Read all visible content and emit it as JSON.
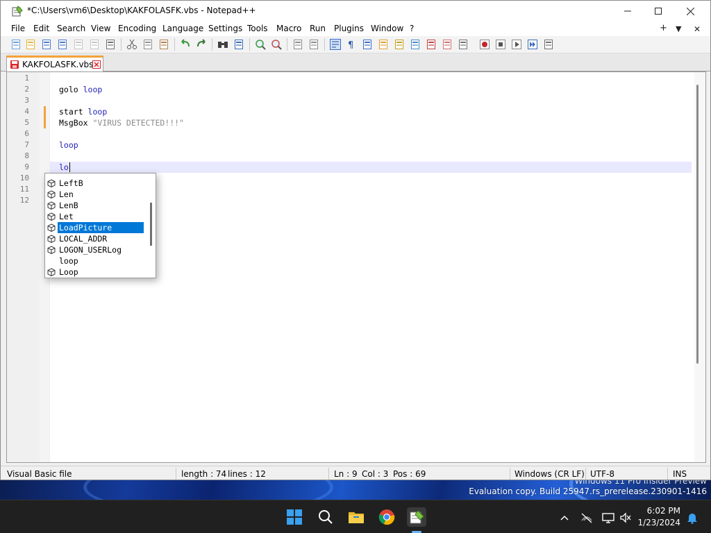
{
  "window": {
    "title": "*C:\\Users\\vm6\\Desktop\\KAKFOLASFK.vbs - Notepad++",
    "minimize_icon": "minimize-icon",
    "maximize_icon": "maximize-icon",
    "close_icon": "close-icon"
  },
  "menu": {
    "items": [
      "File",
      "Edit",
      "Search",
      "View",
      "Encoding",
      "Language",
      "Settings",
      "Tools",
      "Macro",
      "Run",
      "Plugins",
      "Window",
      "?"
    ],
    "right": [
      "+",
      "▼",
      "✕"
    ]
  },
  "toolbar": {
    "icons": [
      "new-file-icon",
      "open-file-icon",
      "save-icon",
      "save-all-icon",
      "close-icon",
      "close-all-icon",
      "print-icon",
      "cut-icon",
      "copy-icon",
      "paste-icon",
      "undo-icon",
      "redo-icon",
      "find-icon",
      "replace-icon",
      "zoom-in-icon",
      "zoom-out-icon",
      "sync-vertical-icon",
      "sync-horizontal-icon",
      "word-wrap-icon",
      "show-all-chars-icon",
      "indent-guide-icon",
      "udl-icon",
      "doc-map-icon",
      "doc-list-icon",
      "function-list-icon",
      "folder-workspace-icon",
      "monitoring-icon",
      "record-macro-icon",
      "stop-record-icon",
      "playback-macro-icon",
      "run-macro-multiple-icon",
      "save-macro-icon"
    ]
  },
  "tab": {
    "label": "KAKFOLASFK.vbs",
    "icon": "modified-file-icon",
    "close_icon": "tab-close-icon"
  },
  "editor": {
    "line_numbers": [
      "1",
      "2",
      "3",
      "4",
      "5",
      "6",
      "7",
      "8",
      "9",
      "10",
      "11",
      "12"
    ],
    "lines": [
      {
        "line": 2,
        "tokens": [
          {
            "t": "golo ",
            "c": "plain"
          },
          {
            "t": "loop",
            "c": "kw"
          }
        ]
      },
      {
        "line": 4,
        "tokens": [
          {
            "t": "start ",
            "c": "plain"
          },
          {
            "t": "loop",
            "c": "kw"
          }
        ]
      },
      {
        "line": 5,
        "tokens": [
          {
            "t": "MsgBox ",
            "c": "plain"
          },
          {
            "t": "\"VIRUS DETECTED!!!\"",
            "c": "str"
          }
        ]
      },
      {
        "line": 7,
        "tokens": [
          {
            "t": "loop",
            "c": "kw"
          }
        ]
      },
      {
        "line": 9,
        "tokens": [
          {
            "t": "lo",
            "c": "kw"
          }
        ]
      }
    ],
    "changed_lines": [
      4,
      5
    ]
  },
  "autocomplete": {
    "items": [
      {
        "label": "LeftB",
        "icon": "function-icon",
        "selected": false
      },
      {
        "label": "Len",
        "icon": "function-icon",
        "selected": false
      },
      {
        "label": "LenB",
        "icon": "function-icon",
        "selected": false
      },
      {
        "label": "Let",
        "icon": "function-icon",
        "selected": false
      },
      {
        "label": "LoadPicture",
        "icon": "function-icon",
        "selected": true
      },
      {
        "label": "LOCAL_ADDR",
        "icon": "function-icon",
        "selected": false
      },
      {
        "label": "LOGON_USERLog",
        "icon": "function-icon",
        "selected": false
      },
      {
        "label": "loop",
        "icon": "",
        "selected": false
      },
      {
        "label": "Loop",
        "icon": "function-icon",
        "selected": false
      }
    ]
  },
  "status": {
    "language": "Visual Basic file",
    "length": "length : 74",
    "lines": "lines : 12",
    "ln": "Ln : 9",
    "col": "Col : 3",
    "pos": "Pos : 69",
    "eol": "Windows (CR LF)",
    "encoding": "UTF-8",
    "mode": "INS"
  },
  "desktop": {
    "watermark_line1": "Windows 11 Pro Insider Preview",
    "watermark_line2": "Evaluation copy. Build 25947.rs_prerelease.230901-1416"
  },
  "taskbar": {
    "apps": [
      "start-icon",
      "search-icon",
      "file-explorer-icon",
      "chrome-icon",
      "notepad-plus-plus-icon"
    ],
    "tray": [
      "chevron-up-icon",
      "network-icon",
      "display-icon",
      "volume-muted-icon",
      "notification-bell-icon"
    ],
    "time": "6:02 PM",
    "date": "1/23/2024"
  },
  "colors": {
    "keyword": "#1f1fb8",
    "string": "#8c8c8c",
    "selection": "#0078d7",
    "tab_accent": "#f3a23a",
    "caret_line": "#e8e8ff"
  }
}
